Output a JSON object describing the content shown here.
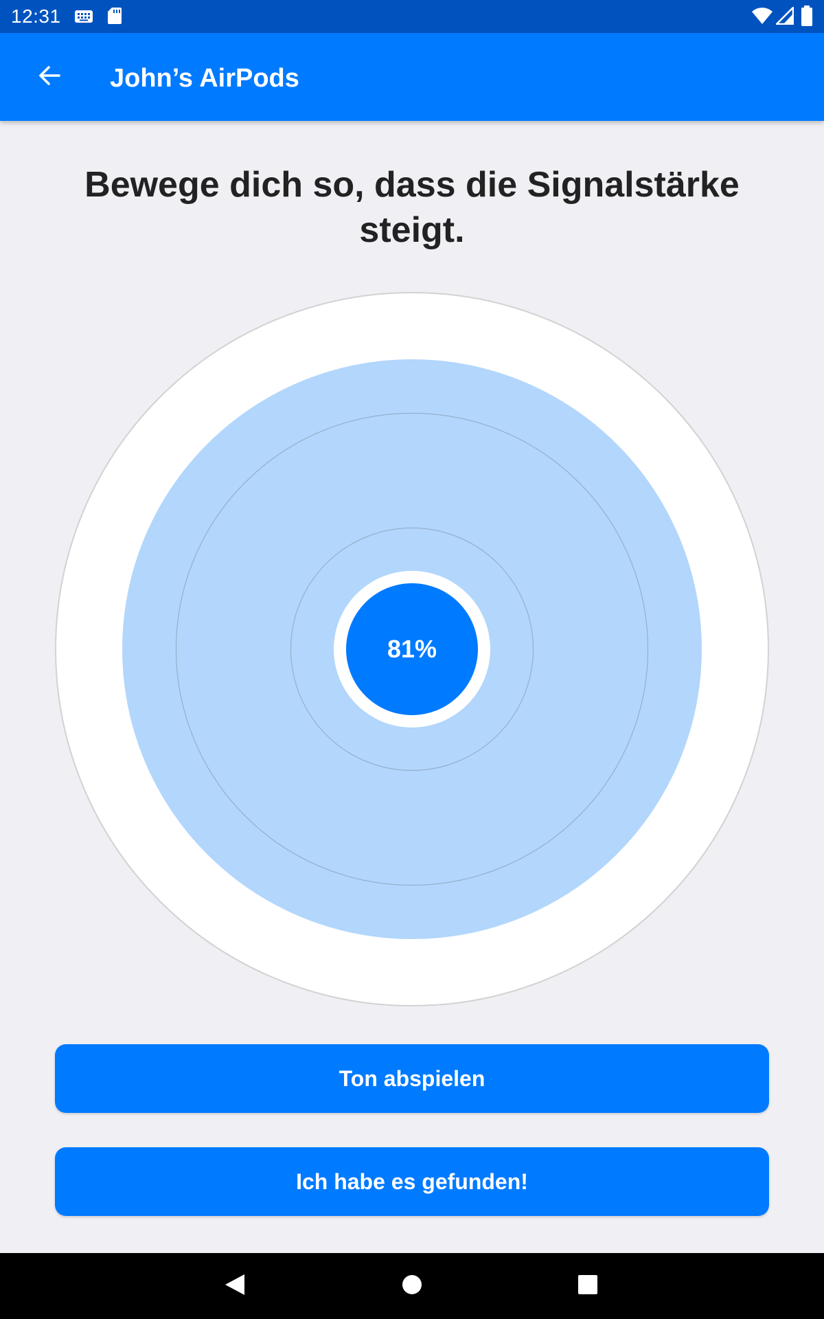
{
  "status_bar": {
    "time": "12:31",
    "icons": [
      "keyboard-icon",
      "sd-card-icon",
      "wifi-icon",
      "cell-signal-icon",
      "battery-icon"
    ]
  },
  "app_bar": {
    "back_icon": "arrow-back-icon",
    "title": "John’s AirPods"
  },
  "instruction": "Bewege dich so, dass die Signalstärke steigt.",
  "signal": {
    "percent_label": "81%",
    "strength": 0.81
  },
  "buttons": {
    "play_sound": "Ton abspielen",
    "found": "Ich habe es gefunden!"
  },
  "nav_bar": {
    "icons": [
      "back-triangle-icon",
      "home-circle-icon",
      "recents-square-icon"
    ]
  },
  "colors": {
    "accent": "#007AFF",
    "status_bar": "#0053BE",
    "signal_fill": "#B2D6FC",
    "background": "#EFEFF4"
  }
}
